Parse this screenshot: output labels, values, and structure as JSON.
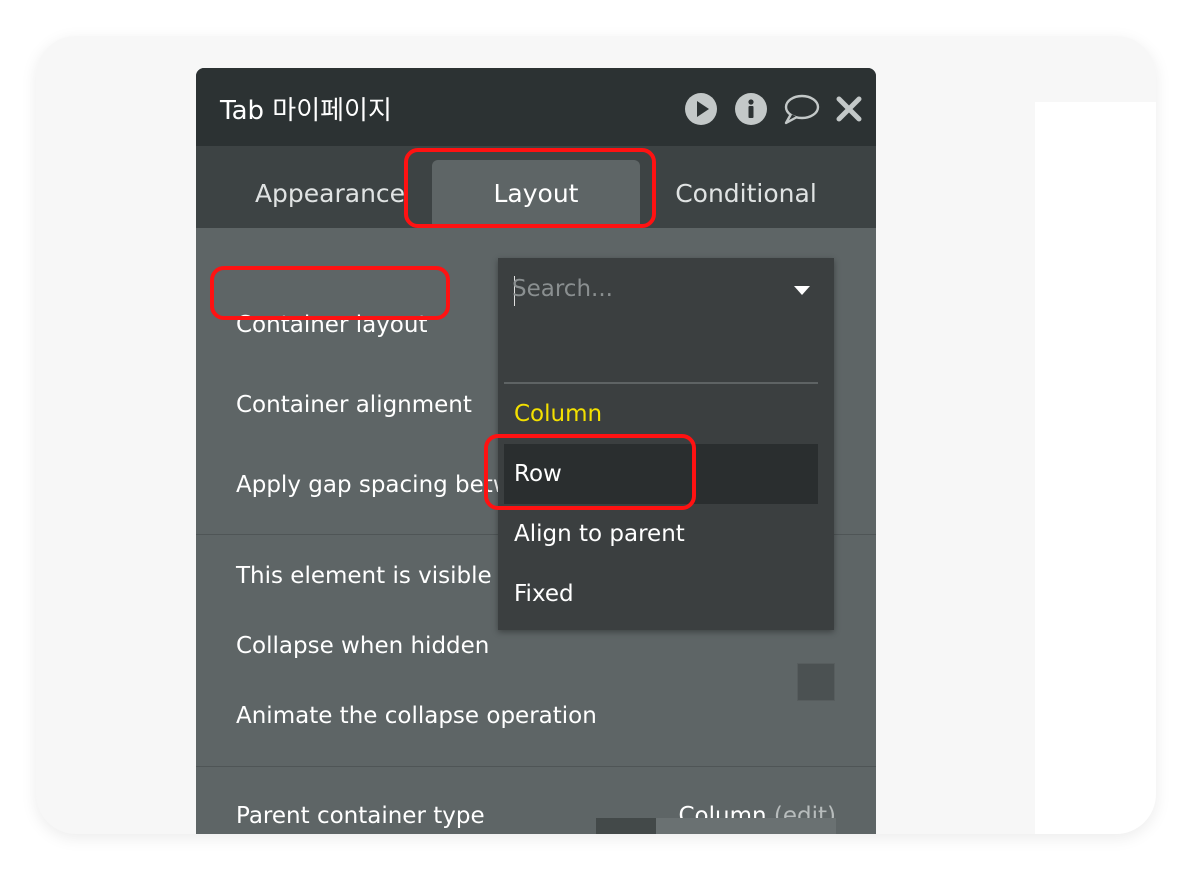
{
  "panel": {
    "title": "Tab 마이페이지",
    "icons": [
      "play-icon",
      "info-icon",
      "comment-icon",
      "close-icon"
    ]
  },
  "tabs": [
    {
      "label": "Appearance",
      "active": false
    },
    {
      "label": "Layout",
      "active": true
    },
    {
      "label": "Conditional",
      "active": false
    }
  ],
  "rows": {
    "container_layout": "Container layout",
    "container_alignment": "Container alignment",
    "apply_gap": "Apply gap spacing betw",
    "visible_on_load": "This element is visible o",
    "collapse_hidden": "Collapse when hidden",
    "animate_collapse": "Animate the collapse operation",
    "parent_container_type": "Parent container type",
    "parent_container_value": "Column",
    "parent_container_edit": "(edit)"
  },
  "dropdown": {
    "placeholder": "Search...",
    "options": [
      "Column",
      "Row",
      "Align to parent",
      "Fixed"
    ],
    "selected": "Column",
    "hovered": "Row"
  },
  "colors": {
    "header_bg": "#2c3233",
    "tabbar_bg": "#3d4344",
    "panel_bg": "#5e6566",
    "dropdown_bg": "#3b3f40",
    "selected_option": "#f3e000",
    "highlight": "#ff1212"
  }
}
